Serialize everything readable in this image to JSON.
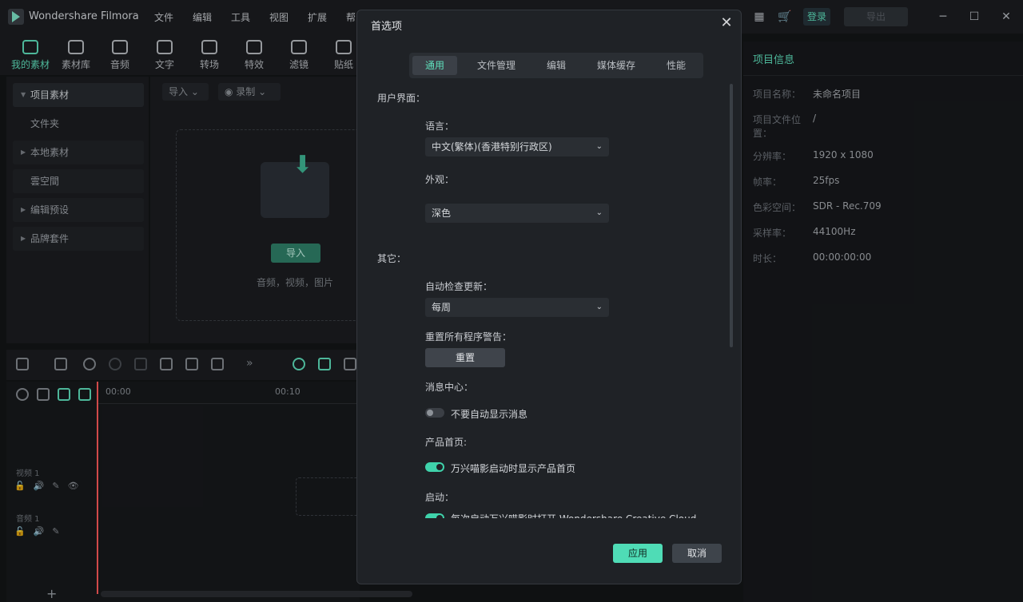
{
  "app": {
    "title": "Wondershare Filmora"
  },
  "menu": [
    "文件",
    "编辑",
    "工具",
    "视图",
    "扩展",
    "帮"
  ],
  "header": {
    "login": "登录",
    "export": "导出"
  },
  "media_tabs": [
    "我的素材",
    "素材库",
    "音频",
    "文字",
    "转场",
    "特效",
    "滤镜",
    "贴纸"
  ],
  "left_panel": {
    "items": [
      "项目素材",
      "文件夹",
      "本地素材",
      "雲空間",
      "编辑预设",
      "品牌套件"
    ]
  },
  "media": {
    "import_dd": "导入",
    "record_dd": "录制",
    "import_button": "导入",
    "hint": "音频，视频，图片"
  },
  "project_info": {
    "title": "项目信息",
    "rows": [
      {
        "k": "项目名称：",
        "v": "未命名项目"
      },
      {
        "k": "项目文件位置：",
        "v": "/"
      },
      {
        "k": "分辨率：",
        "v": "1920 x 1080"
      },
      {
        "k": "帧率：",
        "v": "25fps"
      },
      {
        "k": "色彩空间：",
        "v": "SDR - Rec.709"
      },
      {
        "k": "采样率：",
        "v": "44100Hz"
      },
      {
        "k": "时长：",
        "v": "00:00:00:00"
      }
    ]
  },
  "timeline": {
    "ruler": [
      "00:00",
      "00:10"
    ],
    "tracks": [
      {
        "label": "视频 1"
      },
      {
        "label": "音频 1"
      }
    ]
  },
  "dialog": {
    "title": "首选项",
    "tabs": [
      "通用",
      "文件管理",
      "编辑",
      "媒体缓存",
      "性能"
    ],
    "active_tab": 0,
    "ui_section": "用户界面：",
    "language_label": "语言：",
    "language_value": "中文(繁体)(香港特别行政区)",
    "appearance_label": "外观：",
    "appearance_value": "深色",
    "other_section": "其它：",
    "auto_update_label": "自动检查更新：",
    "auto_update_value": "每周",
    "reset_warnings_label": "重置所有程序警告：",
    "reset_button": "重置",
    "message_center_label": "消息中心：",
    "no_auto_messages": "不要自动显示消息",
    "product_home_label": "产品首页:",
    "show_product_home": "万兴喵影启动时显示产品首页",
    "startup_label": "启动：",
    "startup_option": "每次启动万兴喵影时打开 Wondershare Creative Cloud",
    "apply": "应用",
    "cancel": "取消"
  },
  "colors": {
    "accent": "#5fe0bc",
    "dialog_bg": "#1f2226"
  }
}
